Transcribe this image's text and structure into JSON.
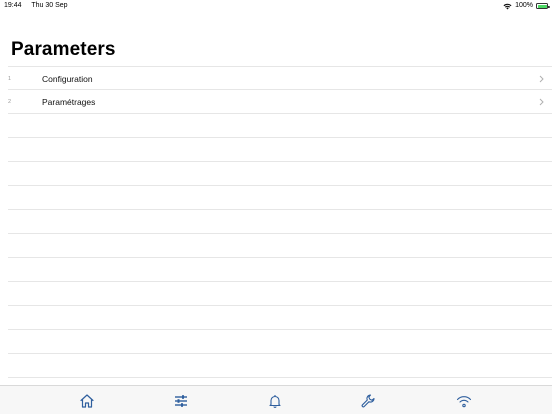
{
  "status_bar": {
    "time": "19:44",
    "date": "Thu 30 Sep",
    "battery_percent": "100%",
    "battery_level": 1.0,
    "icons": [
      "wifi-icon",
      "battery-icon"
    ]
  },
  "page": {
    "title": "Parameters"
  },
  "list": {
    "items": [
      {
        "index": "1",
        "label": "Configuration"
      },
      {
        "index": "2",
        "label": "Paramétrages"
      }
    ]
  },
  "tab_bar": {
    "tabs": [
      {
        "icon": "home-icon",
        "selected": false
      },
      {
        "icon": "sliders-icon",
        "selected": true
      },
      {
        "icon": "bell-icon",
        "selected": false
      },
      {
        "icon": "wrench-icon",
        "selected": false
      },
      {
        "icon": "wifi-icon",
        "selected": false
      }
    ]
  },
  "colors": {
    "accent": "#2f5f9e",
    "separator": "#e6e6e6",
    "tab_bar_bg": "#f7f7f7",
    "battery": "#4cd964"
  }
}
